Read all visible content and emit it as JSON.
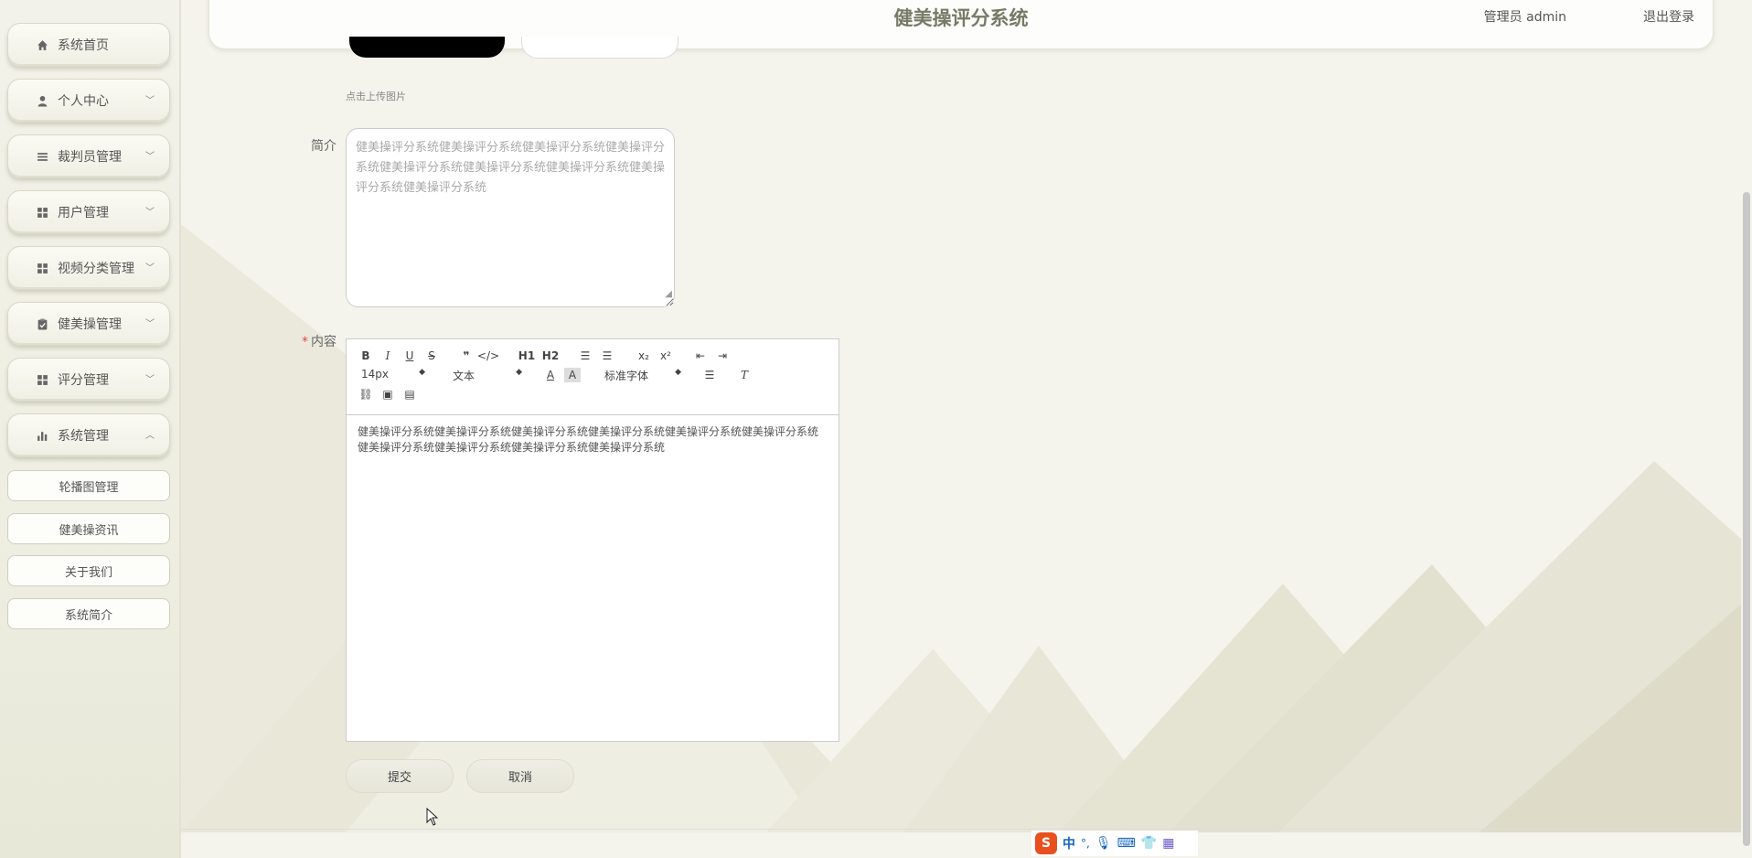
{
  "app": {
    "title": "健美操评分系统"
  },
  "header": {
    "user_label": "管理员 admin",
    "logout_label": "退出登录"
  },
  "sidebar": {
    "items": [
      {
        "label": "系统首页",
        "icon": "home-icon"
      },
      {
        "label": "个人中心",
        "icon": "user-icon"
      },
      {
        "label": "裁判员管理",
        "icon": "list-icon"
      },
      {
        "label": "用户管理",
        "icon": "grid-icon"
      },
      {
        "label": "视频分类管理",
        "icon": "grid-icon"
      },
      {
        "label": "健美操管理",
        "icon": "clipboard-icon"
      },
      {
        "label": "评分管理",
        "icon": "grid-icon"
      },
      {
        "label": "系统管理",
        "icon": "bar-chart-icon"
      }
    ],
    "sub_items": [
      {
        "label": "轮播图管理"
      },
      {
        "label": "健美操资讯"
      },
      {
        "label": "关于我们"
      },
      {
        "label": "系统简介"
      }
    ]
  },
  "form": {
    "upload_hint": "点击上传图片",
    "intro_label": "简介",
    "intro_value": "健美操评分系统健美操评分系统健美操评分系统健美操评分系统健美操评分系统健美操评分系统健美操评分系统健美操评分系统健美操评分系统",
    "content_label": "内容",
    "content_value": "健美操评分系统健美操评分系统健美操评分系统健美操评分系统健美操评分系统健美操评分系统健美操评分系统健美操评分系统健美操评分系统健美操评分系统",
    "submit_label": "提交",
    "cancel_label": "取消"
  },
  "editor_toolbar": {
    "font_size": "14px",
    "text_style": "文本",
    "font_family": "标准字体",
    "h1": "H1",
    "h2": "H2",
    "bold": "B",
    "italic": "I",
    "underline": "U",
    "strike": "S",
    "sub": "x₂",
    "sup": "x²"
  },
  "ime": {
    "mode": "中",
    "punct": "°,"
  },
  "colors": {
    "accent": "#777a66",
    "required": "#e04b4b",
    "bg": "#f4f3ec"
  }
}
